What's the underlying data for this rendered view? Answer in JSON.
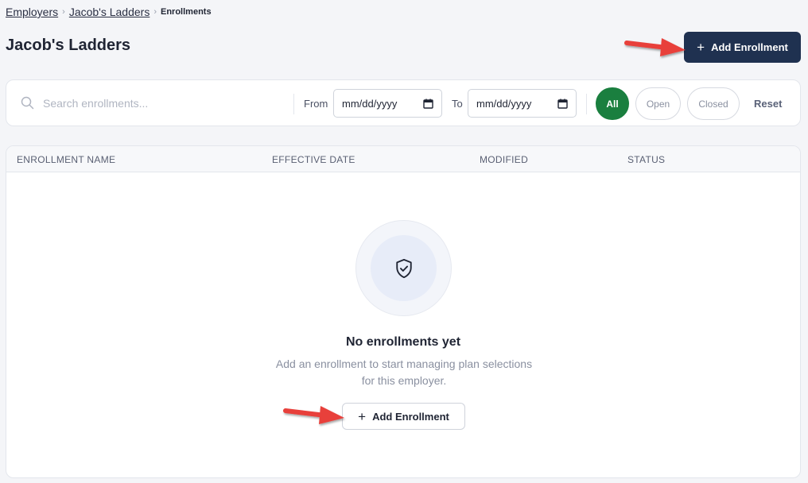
{
  "breadcrumb": {
    "items": [
      "Employers",
      "Jacob's Ladders"
    ],
    "current": "Enrollments"
  },
  "header": {
    "title": "Jacob's Ladders",
    "add_label": "Add Enrollment"
  },
  "filters": {
    "search_placeholder": "Search enrollments...",
    "from_label": "From",
    "to_label": "To",
    "from_value": "mm/dd/yyyy",
    "to_value": "mm/dd/yyyy",
    "status_options": [
      "All",
      "Open",
      "Closed"
    ],
    "selected_status": "All",
    "reset_label": "Reset"
  },
  "table": {
    "columns": [
      "ENROLLMENT NAME",
      "EFFECTIVE DATE",
      "MODIFIED",
      "STATUS"
    ],
    "rows": []
  },
  "empty_state": {
    "icon": "shield-check-icon",
    "title": "No enrollments yet",
    "description_line1": "Add an enrollment to start managing plan selections",
    "description_line2": "for this employer.",
    "button_label": "Add Enrollment"
  },
  "colors": {
    "primary": "#1f3150",
    "active_pill": "#1a7f3f",
    "annotation_arrow": "#e8413b"
  }
}
